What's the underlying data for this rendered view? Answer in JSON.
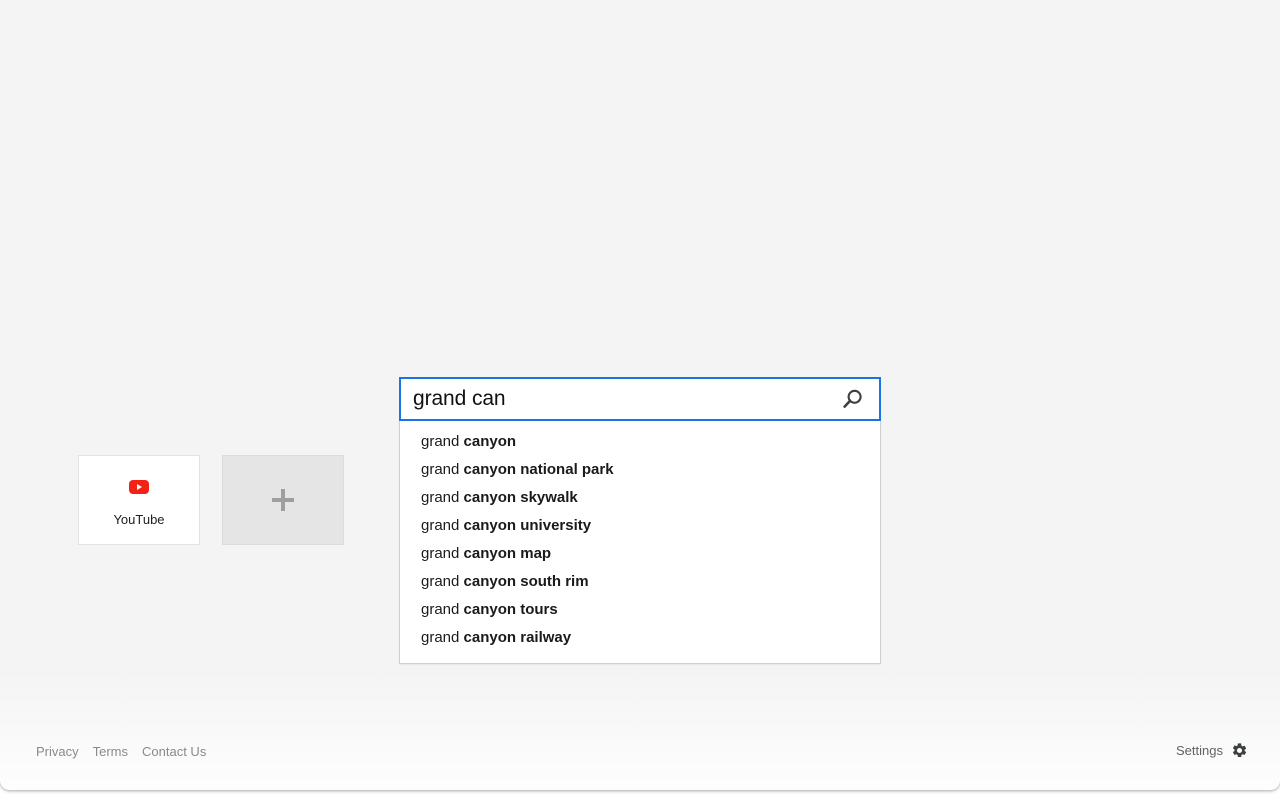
{
  "page": {
    "background_color": "#f4f4f4",
    "accent_color": "#1a73e8"
  },
  "search": {
    "value": "grand can",
    "placeholder": "Search the web",
    "submit_label": "Search",
    "icon": "magnifier-icon",
    "border_color": "#1a73e8"
  },
  "suggestions": {
    "items": [
      {
        "prefix": "grand ",
        "rest": "canyon"
      },
      {
        "prefix": "grand ",
        "rest": "canyon national park"
      },
      {
        "prefix": "grand ",
        "rest": "canyon skywalk"
      },
      {
        "prefix": "grand ",
        "rest": "canyon university"
      },
      {
        "prefix": "grand ",
        "rest": "canyon map"
      },
      {
        "prefix": "grand ",
        "rest": "canyon south rim"
      },
      {
        "prefix": "grand ",
        "rest": "canyon tours"
      },
      {
        "prefix": "grand ",
        "rest": "canyon railway"
      }
    ]
  },
  "shortcuts": {
    "tiles": [
      {
        "label": "YouTube",
        "icon": "youtube-icon",
        "icon_color": "#f22216",
        "type": "site"
      },
      {
        "label": "",
        "icon": "plus-icon",
        "icon_color": "#9e9e9e",
        "type": "add"
      }
    ]
  },
  "footer": {
    "links": [
      {
        "label": "Privacy"
      },
      {
        "label": "Terms"
      },
      {
        "label": "Contact Us"
      }
    ],
    "settings": {
      "label": "Settings",
      "icon": "gear-icon"
    }
  }
}
